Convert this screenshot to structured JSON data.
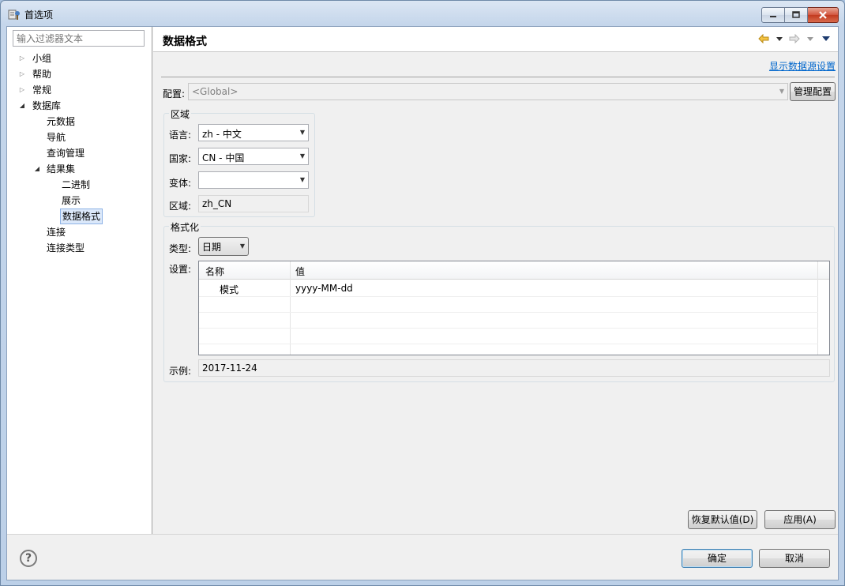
{
  "window": {
    "title": "首选项"
  },
  "sidebar": {
    "filter_placeholder": "输入过滤器文本",
    "items": [
      {
        "label": "小组",
        "arrow": "▷"
      },
      {
        "label": "帮助",
        "arrow": "▷"
      },
      {
        "label": "常规",
        "arrow": "▷"
      },
      {
        "label": "数据库",
        "arrow": "◢"
      },
      {
        "label": "元数据"
      },
      {
        "label": "导航"
      },
      {
        "label": "查询管理"
      },
      {
        "label": "结果集",
        "arrow": "◢"
      },
      {
        "label": "二进制"
      },
      {
        "label": "展示"
      },
      {
        "label": "数据格式"
      },
      {
        "label": "连接"
      },
      {
        "label": "连接类型"
      }
    ]
  },
  "page": {
    "title": "数据格式",
    "show_datasource_link": "显示数据源设置",
    "config": {
      "label": "配置:",
      "value": "<Global>",
      "manage_button": "管理配置"
    },
    "region_group": {
      "title": "区域",
      "language_label": "语言:",
      "language_value": "zh - 中文",
      "country_label": "国家:",
      "country_value": "CN - 中国",
      "variant_label": "变体:",
      "variant_value": "",
      "region_label": "区域:",
      "region_value": "zh_CN"
    },
    "format_group": {
      "title": "格式化",
      "type_label": "类型:",
      "type_value": "日期",
      "settings_label": "设置:",
      "table": {
        "columns": [
          "名称",
          "值"
        ],
        "rows": [
          {
            "name": "模式",
            "value": "yyyy-MM-dd"
          }
        ]
      },
      "sample_label": "示例:",
      "sample_value": "2017-11-24"
    },
    "restore_defaults_button": "恢复默认值(D)",
    "apply_button": "应用(A)"
  },
  "footer": {
    "help": "?",
    "ok_button": "确定",
    "cancel_button": "取消"
  }
}
